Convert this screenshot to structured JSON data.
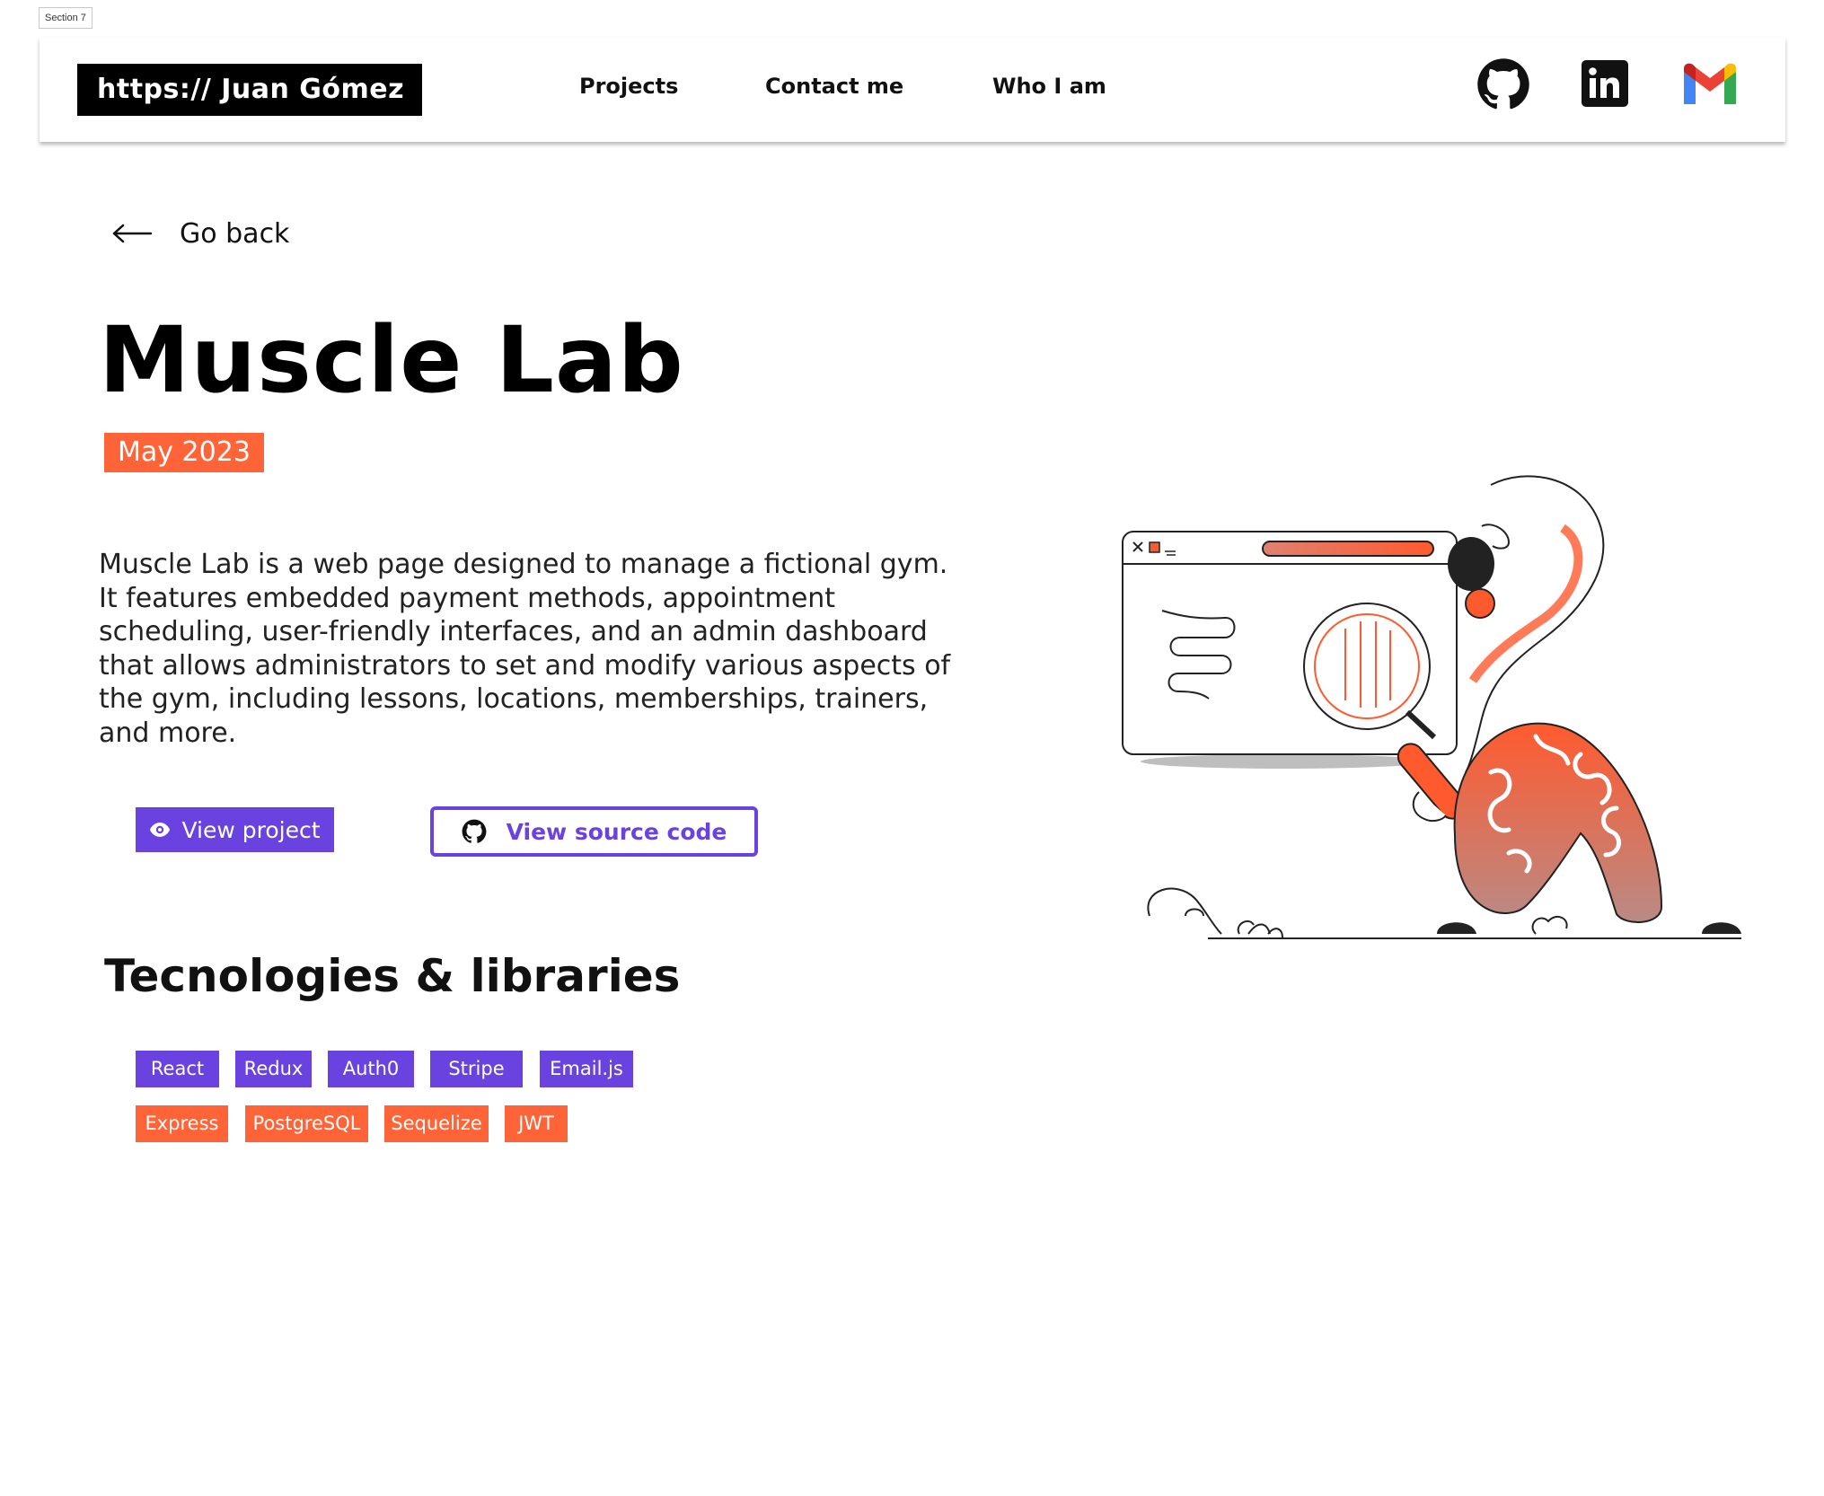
{
  "frame_label": "Section 7",
  "header": {
    "brand": "https:// Juan Gómez",
    "nav": {
      "projects": "Projects",
      "contact": "Contact me",
      "about": "Who I am"
    },
    "social_icons": [
      "github-icon",
      "linkedin-icon",
      "gmail-icon"
    ]
  },
  "back": {
    "label": "Go back",
    "icon": "arrow-left-icon"
  },
  "project": {
    "title": "Muscle Lab",
    "date": "May 2023",
    "description": "Muscle Lab is a web page designed to manage a fictional gym. It features embedded payment methods, appointment scheduling, user-friendly interfaces, and an admin dashboard that allows administrators to set and modify various aspects of the gym, including lessons, locations, memberships, trainers, and more."
  },
  "actions": {
    "view_project": "View project",
    "view_source": "View source code"
  },
  "tech": {
    "title": "Tecnologies & libraries",
    "frontend": [
      "React",
      "Redux",
      "Auth0",
      "Stripe",
      "Email.js"
    ],
    "backend": [
      "Express",
      "PostgreSQL",
      "Sequelize",
      "JWT"
    ]
  },
  "colors": {
    "accent_purple": "#6a42e0",
    "accent_orange": "#ff6338",
    "brand_bg": "#000000"
  }
}
